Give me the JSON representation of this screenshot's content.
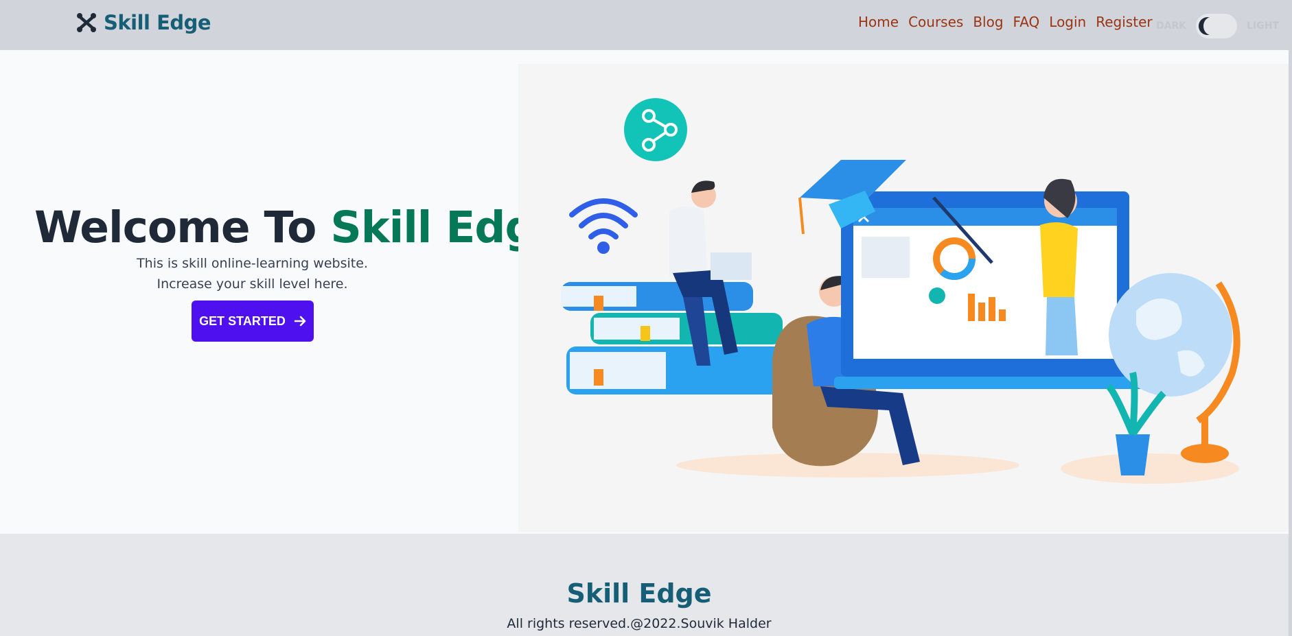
{
  "navbar": {
    "brand": "Skill Edge",
    "links": [
      "Home",
      "Courses",
      "Blog",
      "FAQ",
      "Login",
      "Register"
    ],
    "theme": {
      "dark_label": "DARK",
      "light_label": "LIGHT"
    }
  },
  "hero": {
    "title_prefix": "Welcome To ",
    "title_accent": "Skill Edge",
    "line1": "This is skill online-learning website.",
    "line2": "Increase your skill level here.",
    "cta_label": "GET STARTED"
  },
  "footer": {
    "brand": "Skill Edge",
    "copyright": "All rights reserved.@2022.Souvik Halder"
  },
  "colors": {
    "brand": "#155e75",
    "accent": "#047857",
    "nav_link": "#9a3412",
    "cta": "#4f10f0"
  },
  "icons": [
    "joomla-logo-icon",
    "arrow-right-icon",
    "share-icon",
    "wifi-icon"
  ]
}
